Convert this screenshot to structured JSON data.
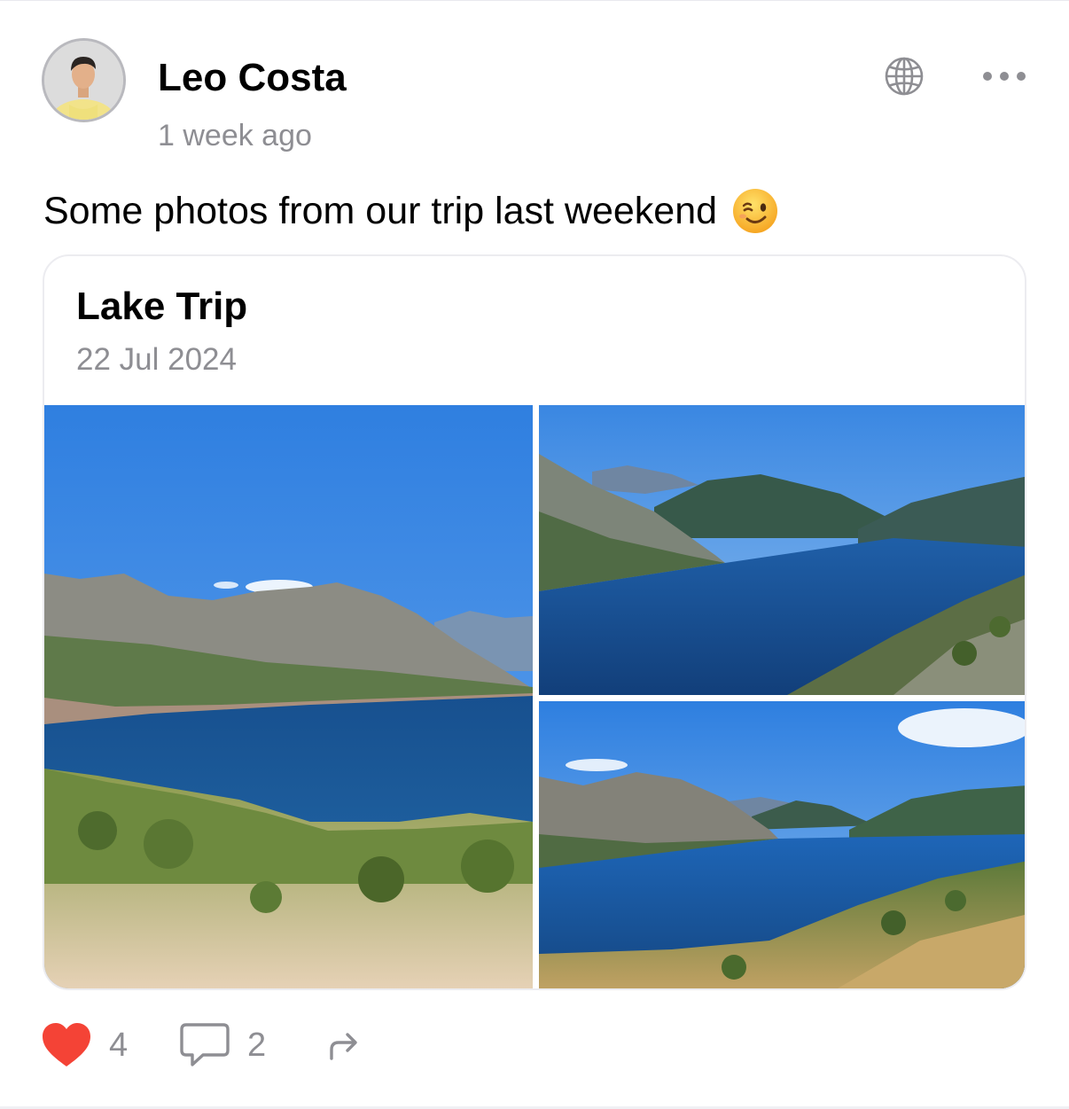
{
  "post": {
    "author": {
      "name": "Leo Costa",
      "avatar_icon": "avatar-photo"
    },
    "timestamp": "1 week ago",
    "visibility_icon": "globe-icon",
    "menu_icon": "more-horizontal-icon",
    "text": "Some photos from our trip last weekend",
    "text_emoji": "winking-face-emoji",
    "album": {
      "title": "Lake Trip",
      "date": "22 Jul 2024",
      "photo_count": 3
    },
    "actions": {
      "likes": "4",
      "comments": "2",
      "like_icon": "heart-icon",
      "comment_icon": "speech-bubble-icon",
      "share_icon": "share-arrow-icon"
    }
  },
  "colors": {
    "heart": "#f44336",
    "secondary_text": "#8e8e93",
    "icon_gray": "#8e8e93",
    "card_border": "#ececf0"
  }
}
